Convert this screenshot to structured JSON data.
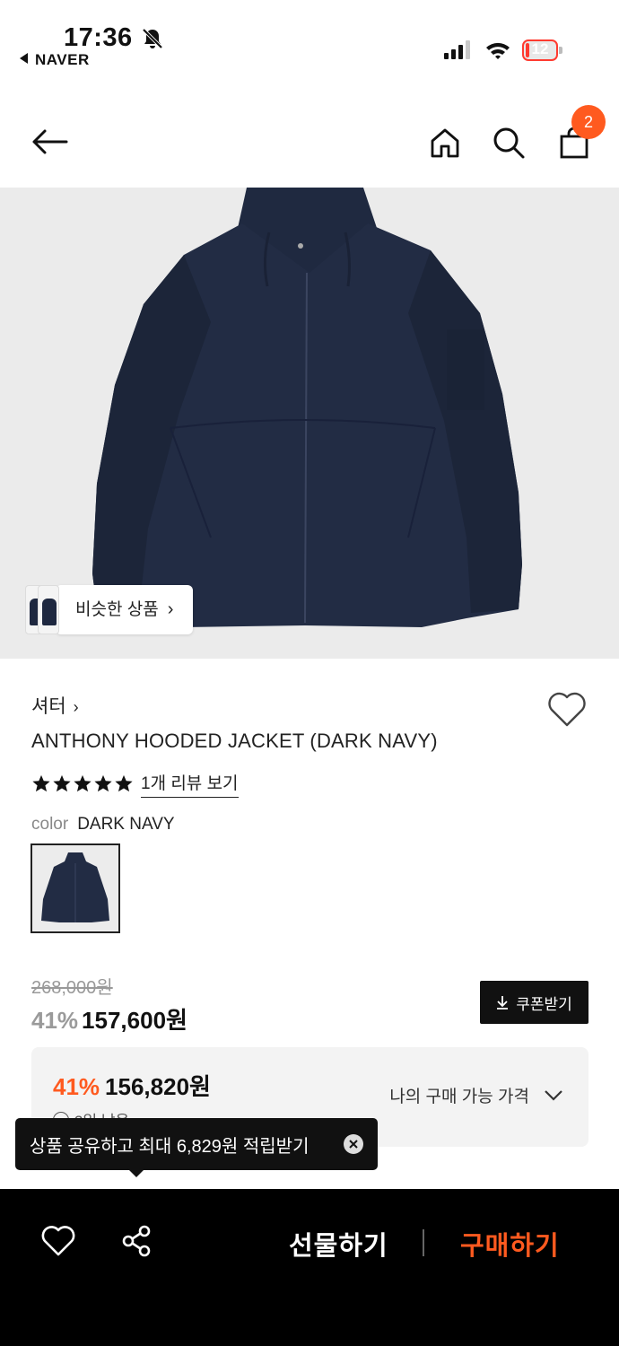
{
  "status_bar": {
    "time": "17:36",
    "back_app": "NAVER",
    "battery": "12",
    "battery_level": 0.12,
    "battery_color": "#ff3b30"
  },
  "header": {
    "cart_count": "2",
    "badge_color": "#ff5a1f"
  },
  "image": {
    "similar_label": "비슷한 상품"
  },
  "product": {
    "brand": "셔터",
    "name": "ANTHONY HOODED JACKET (DARK NAVY)",
    "rating_stars": 5,
    "review_link": "1개 리뷰 보기",
    "color_label": "color",
    "color_value": "DARK NAVY"
  },
  "price": {
    "original": "268,000원",
    "discount": "41%",
    "sale": "157,600원",
    "coupon_label": "쿠폰받기"
  },
  "my_price": {
    "discount": "41%",
    "amount": "156,820원",
    "note": "3일 남음",
    "link_label": "나의 구매 가능 가격",
    "accent": "#ff5a1f"
  },
  "tooltip": {
    "text": "상품 공유하고 최대 6,829원 적립받기"
  },
  "bottom_bar": {
    "gift_label": "선물하기",
    "buy_label": "구매하기",
    "buy_color": "#ff5a1f"
  }
}
